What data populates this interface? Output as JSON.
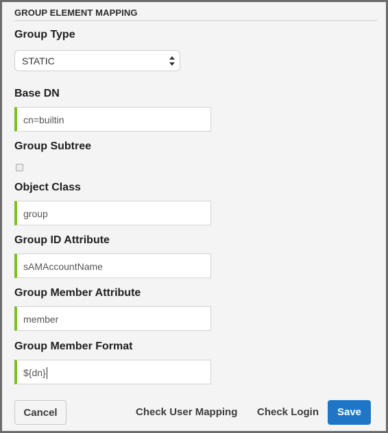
{
  "section": {
    "title": "GROUP ELEMENT MAPPING"
  },
  "fields": {
    "group_type": {
      "label": "Group Type",
      "selected": "STATIC"
    },
    "base_dn": {
      "label": "Base DN",
      "value": "cn=builtin"
    },
    "group_subtree": {
      "label": "Group Subtree",
      "checked": false
    },
    "object_class": {
      "label": "Object Class",
      "value": "group"
    },
    "group_id_attribute": {
      "label": "Group ID Attribute",
      "value": "sAMAccountName"
    },
    "group_member_attribute": {
      "label": "Group Member Attribute",
      "value": "member"
    },
    "group_member_format": {
      "label": "Group Member Format",
      "value": "${dn}"
    }
  },
  "buttons": {
    "cancel": "Cancel",
    "check_user_mapping": "Check User Mapping",
    "check_login": "Check Login",
    "save": "Save"
  },
  "colors": {
    "accent_green": "#7ac11b",
    "primary_blue": "#1f76c7"
  }
}
